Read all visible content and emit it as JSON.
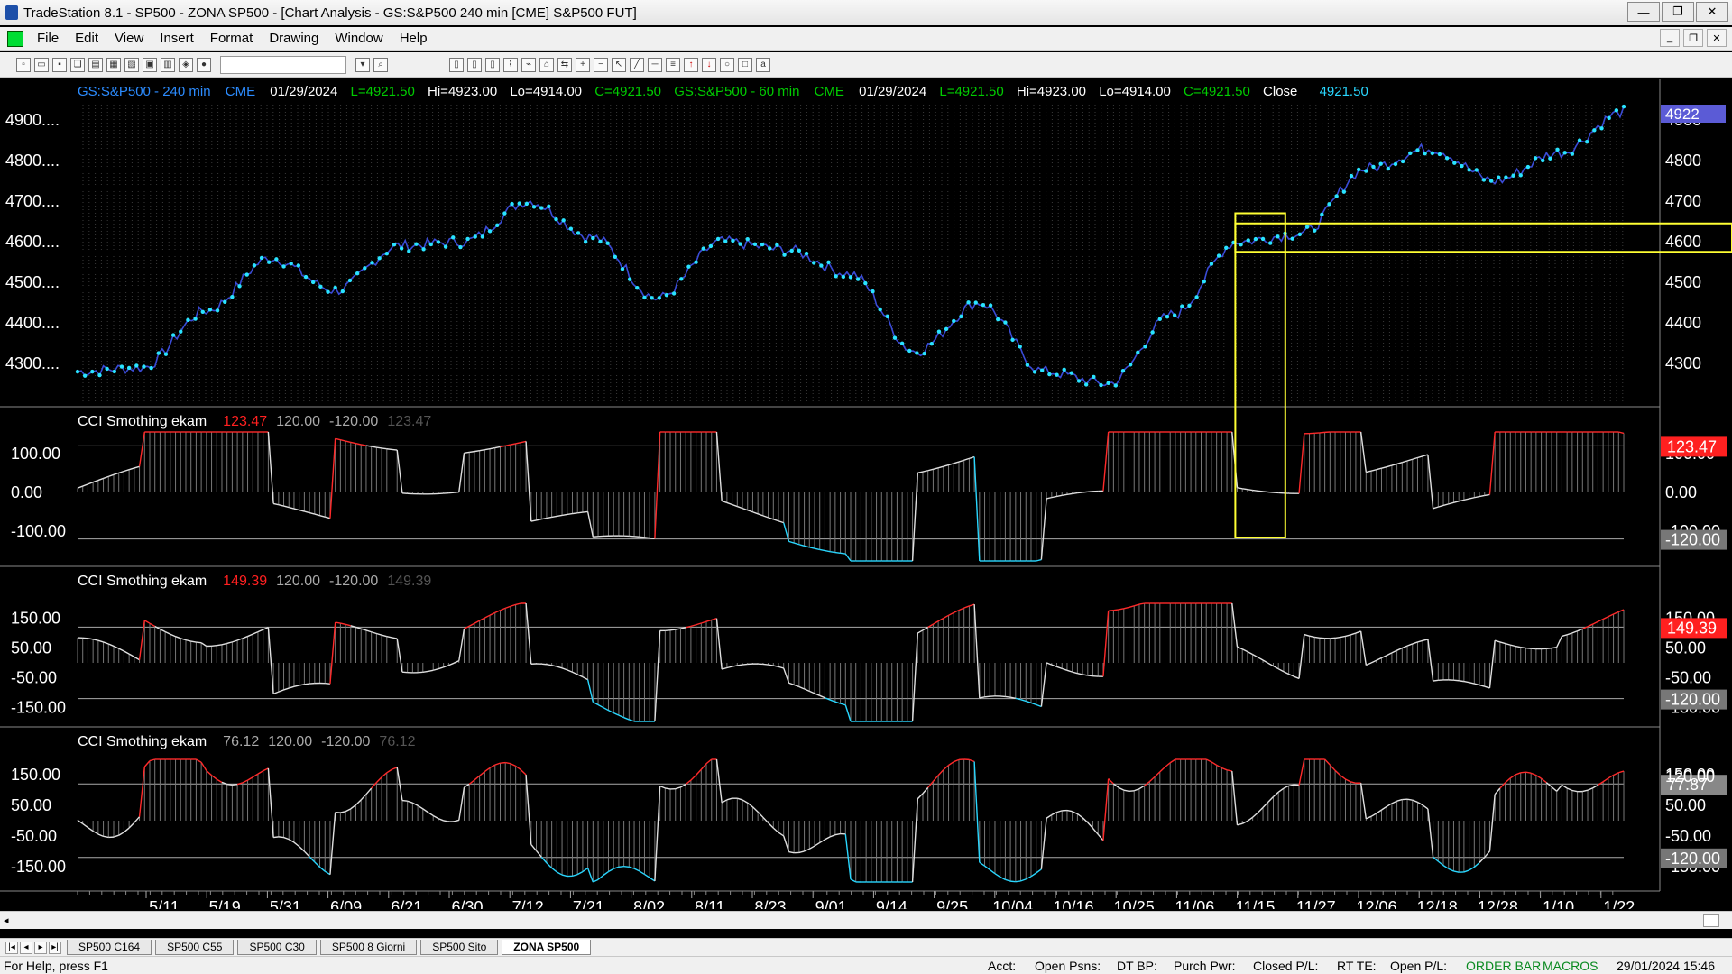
{
  "window": {
    "title": "TradeStation 8.1 - SP500 - ZONA SP500 - [Chart Analysis - GS:S&P500  240 min  [CME] S&P500 FUT]"
  },
  "menu": [
    "File",
    "Edit",
    "View",
    "Insert",
    "Format",
    "Drawing",
    "Window",
    "Help"
  ],
  "chart": {
    "header": {
      "sym1": "GS:S&P500 - 240 min",
      "ex1": "CME",
      "date1": "01/29/2024",
      "last1": "L=4921.50",
      "hi1": "Hi=4923.00",
      "lo1": "Lo=4914.00",
      "close1": "C=4921.50",
      "sym2": "GS:S&P500 - 60 min",
      "ex2": "CME",
      "date2": "01/29/2024",
      "last2": "L=4921.50",
      "hi2": "Hi=4923.00",
      "lo2": "Lo=4914.00",
      "close2": "C=4921.50",
      "closeLabel": "Close",
      "closeVal": "4921.50"
    },
    "price_axis": [
      "4900....",
      "4800....",
      "4700....",
      "4600....",
      "4500....",
      "4400....",
      "4300...."
    ],
    "price_right": [
      "4900",
      "4800",
      "4700",
      "4600",
      "4500",
      "4400",
      "4300"
    ],
    "price_badge": "4922",
    "panes": [
      {
        "name": "CCI Smothing ekam",
        "value": "123.47",
        "upper": "120.00",
        "lower": "-120.00",
        "ghost": "123.47",
        "left_ticks": [
          "100.00",
          "0.00",
          "-100.00"
        ],
        "right_ticks": [
          "100.00",
          "0.00",
          "-100.00"
        ],
        "badge": "123.47",
        "badge_lower": "-120.00"
      },
      {
        "name": "CCI Smothing ekam",
        "value": "149.39",
        "upper": "120.00",
        "lower": "-120.00",
        "ghost": "149.39",
        "left_ticks": [
          "150.00",
          "50.00",
          "-50.00",
          "-150.00"
        ],
        "right_ticks": [
          "150.00",
          "50.00",
          "-50.00",
          "-150.00"
        ],
        "badge": "149.39",
        "badge_lower": "-120.00"
      },
      {
        "name": "CCI Smothing ekam",
        "value": "76.12",
        "upper": "120.00",
        "lower": "-120.00",
        "ghost": "76.12",
        "left_ticks": [
          "150.00",
          "50.00",
          "-50.00",
          "-150.00"
        ],
        "right_ticks": [
          "150.00",
          "50.00",
          "-50.00",
          "-150.00"
        ],
        "badge": "77.87",
        "badge_upper": "120.00",
        "badge_lower": "-120.00"
      }
    ],
    "dates": [
      "5/11",
      "5/19",
      "5/31",
      "6/09",
      "6/21",
      "6/30",
      "7/12",
      "7/21",
      "8/02",
      "8/11",
      "8/23",
      "9/01",
      "9/14",
      "9/25",
      "10/04",
      "10/16",
      "10/25",
      "11/06",
      "11/15",
      "11/27",
      "12/06",
      "12/18",
      "12/28",
      "1/10",
      "1/22"
    ]
  },
  "chart_data": {
    "type": "line",
    "title": "",
    "x": [
      "5/11",
      "5/19",
      "5/31",
      "6/09",
      "6/21",
      "6/30",
      "7/12",
      "7/21",
      "8/02",
      "8/11",
      "8/23",
      "9/01",
      "9/14",
      "9/25",
      "10/04",
      "10/16",
      "10/25",
      "11/06",
      "11/15",
      "11/27",
      "12/06",
      "12/18",
      "12/28",
      "1/10",
      "1/22"
    ],
    "series": [
      {
        "name": "GS:S&P500 - 240 min",
        "values": [
          4280,
          4290,
          4430,
          4560,
          4480,
          4590,
          4600,
          4700,
          4610,
          4460,
          4600,
          4580,
          4520,
          4330,
          4450,
          4280,
          4250,
          4420,
          4600,
          4620,
          4780,
          4830,
          4750,
          4820,
          4920
        ]
      }
    ],
    "ylim": [
      4200,
      4960
    ],
    "annotations": {
      "rect_time": [
        "11/06",
        "11/27"
      ],
      "zone_price": [
        4575,
        4645
      ]
    }
  },
  "tabs": [
    "SP500 C164",
    "SP500 C55",
    "SP500 C30",
    "SP500 8 Giorni",
    "SP500 Sito",
    "ZONA SP500"
  ],
  "status": {
    "help": "For Help, press F1",
    "acct": "Acct:",
    "open_psns": "Open Psns:",
    "dt_bp": "DT BP:",
    "purch": "Purch Pwr:",
    "closed_pl": "Closed P/L:",
    "rt_te": "RT TE:",
    "open_pl": "Open P/L:",
    "orderbar": "ORDER BAR",
    "macros": "MACROS",
    "datetime": "29/01/2024 15:46"
  }
}
